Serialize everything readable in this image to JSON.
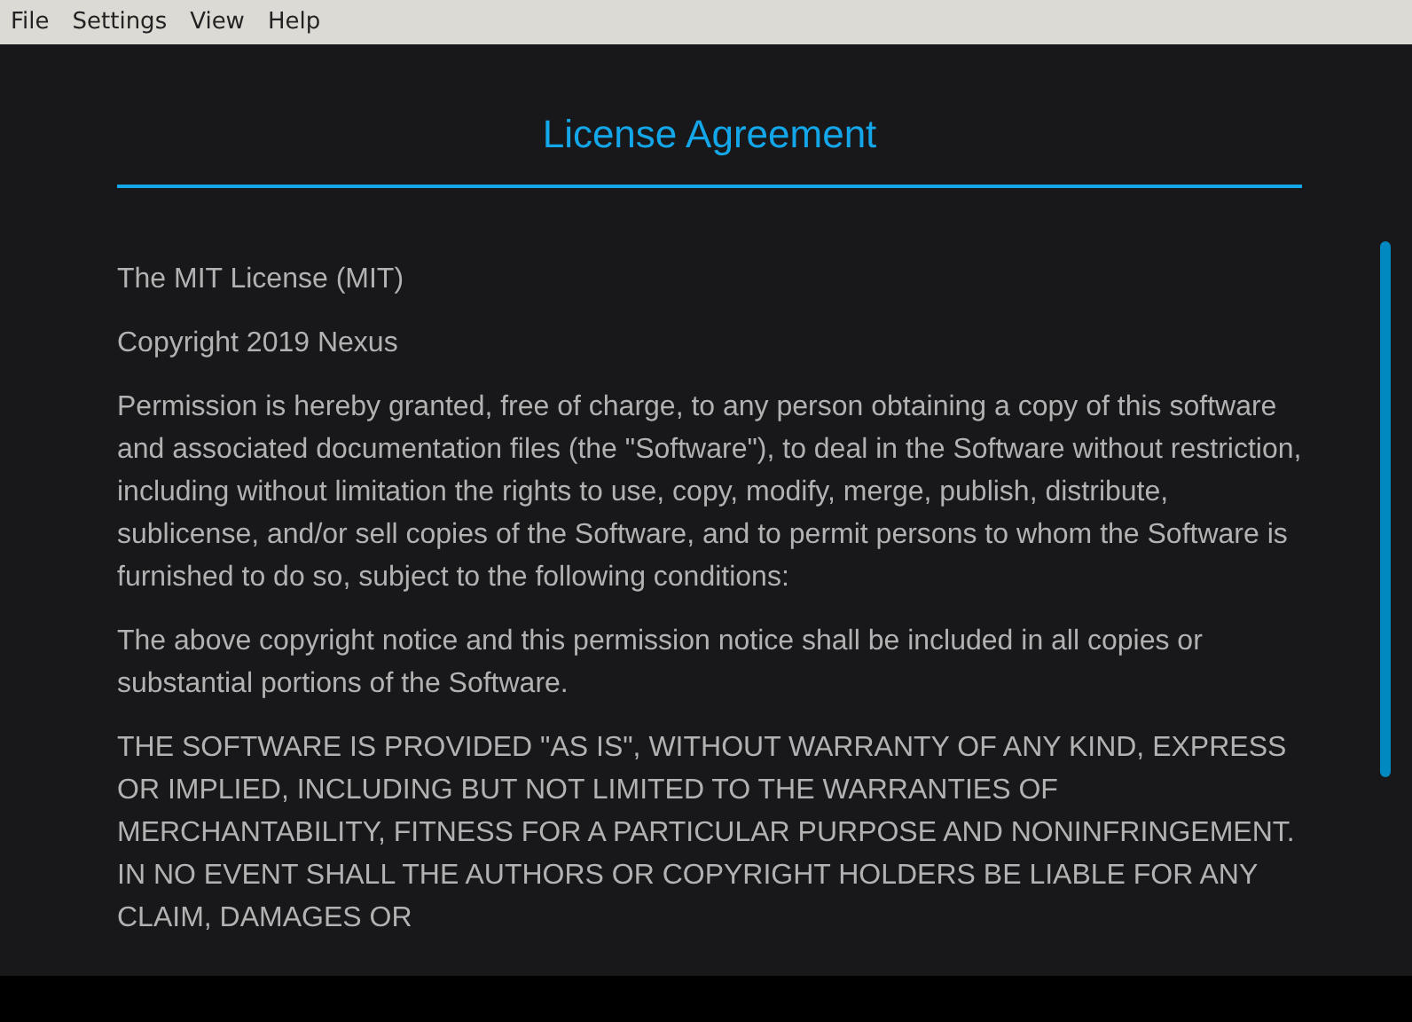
{
  "menu": [
    "File",
    "Settings",
    "View",
    "Help"
  ],
  "title": "License Agreement",
  "paragraphs": [
    "The MIT License (MIT)",
    "Copyright 2019 Nexus",
    "Permission is hereby granted, free of charge, to any person obtaining a copy of this software and associated documentation files (the \"Software\"), to deal in the Software without restriction, including without limitation the rights to use, copy, modify, merge, publish, distribute, sublicense, and/or sell copies of the Software, and to permit persons to whom the Software is furnished to do so, subject to the following conditions:",
    "The above copyright notice and this permission notice shall be included in all copies or substantial portions of the Software.",
    "THE SOFTWARE IS PROVIDED \"AS IS\", WITHOUT WARRANTY OF ANY KIND, EXPRESS OR IMPLIED, INCLUDING BUT NOT LIMITED TO THE WARRANTIES OF MERCHANTABILITY, FITNESS FOR A PARTICULAR PURPOSE AND NONINFRINGEMENT. IN NO EVENT SHALL THE AUTHORS OR COPYRIGHT HOLDERS BE LIABLE FOR ANY CLAIM, DAMAGES OR"
  ]
}
